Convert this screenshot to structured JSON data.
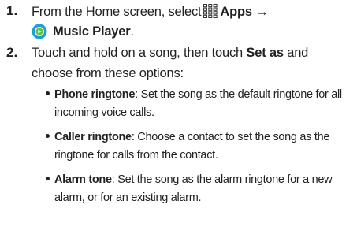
{
  "steps": [
    {
      "number": "1.",
      "text_a": "From the Home screen, select",
      "apps_label": "Apps",
      "arrow": "→",
      "music_label": "Music Player",
      "period": "."
    },
    {
      "number": "2.",
      "line1_a": "Touch and hold on a song, then touch",
      "set_as": "Set as",
      "line1_b": "and",
      "line2": "choose from these options:"
    }
  ],
  "options": [
    {
      "term": "Phone ringtone",
      "desc_line1": ": Set the song as the default ringtone for all",
      "desc_line2": "incoming voice calls."
    },
    {
      "term": "Caller ringtone",
      "desc_line1": ": Choose a contact to set the song as the",
      "desc_line2": "ringtone for calls from the contact."
    },
    {
      "term": "Alarm tone",
      "desc_line1": ": Set the song as the alarm ringtone for a new",
      "desc_line2": "alarm, or for an existing alarm."
    }
  ],
  "icons": {
    "apps": "apps-grid-icon",
    "music": "music-player-icon"
  },
  "colors": {
    "text": "#222222",
    "music_icon_outer": "#1e9fd6",
    "music_icon_inner": "#ffffff"
  }
}
